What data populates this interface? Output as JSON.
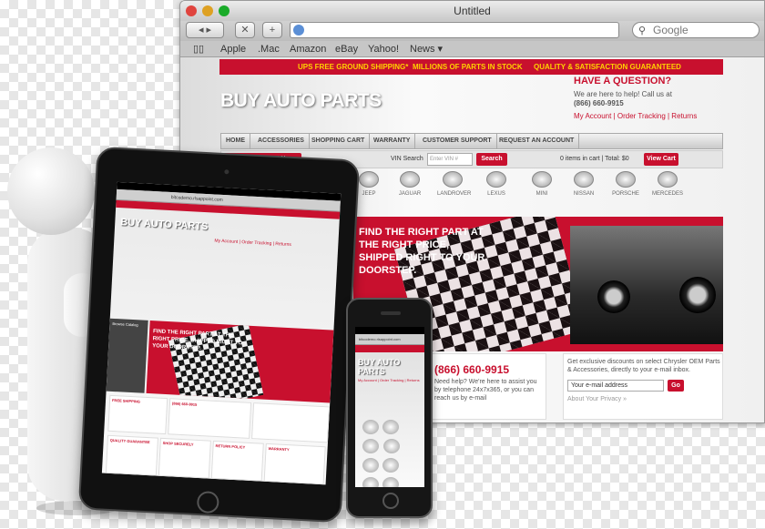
{
  "browser": {
    "title": "Untitled",
    "url": "",
    "search_placeholder": "Google",
    "nav_back": "◂ ▸",
    "nav_stop": "✕",
    "nav_add": "+",
    "bookmarks_icon": "book-icon",
    "bookmarks": [
      "Apple",
      ".Mac",
      "Amazon",
      "eBay",
      "Yahoo!",
      "News ▾"
    ]
  },
  "site": {
    "promo": [
      "UPS FREE GROUND SHIPPING*",
      "MILLIONS OF PARTS IN STOCK",
      "QUALITY & SATISFACTION GUARANTEED"
    ],
    "logo": "BUY AUTO PARTS",
    "question": "HAVE A QUESTION?",
    "help_line1": "We are here to help! Call us at",
    "help_phone": "(866) 660-9915",
    "account_links": "My Account | Order Tracking | Returns",
    "nav": [
      "HOME",
      "ACCESSORIES",
      "SHOPPING CART",
      "WARRANTY",
      "CUSTOMER SUPPORT",
      "REQUEST AN ACCOUNT"
    ],
    "search_by_part": "Search By Part N...",
    "vin_label": "VIN Search",
    "vin_placeholder": "Enter VIN #",
    "search_btn": "Search",
    "cart_text": "0 items in cart | Total: $0",
    "view_cart": "View Cart",
    "brands": [
      "JEEP",
      "JAGUAR",
      "LANDROVER",
      "LEXUS",
      "MINI",
      "NISSAN",
      "PORSCHE",
      "MERCEDES"
    ],
    "hero_text": "FIND THE RIGHT PART AT THE RIGHT PRICE, SHIPPED RIGHT TO YOUR DOORSTEP.",
    "phone_big": "(866) 660-9915",
    "phone_sub": "Need help? We're here to assist you by telephone 24x7x365, or you can reach us by e-mail",
    "news_text": "Get exclusive discounts on select Chrysler OEM Parts & Accessories, directly to your e-mail inbox.",
    "email_placeholder": "Your e-mail address",
    "go_btn": "Go",
    "privacy": "About Your Privacy »"
  },
  "tablet": {
    "url": "bitcodemo.rlsappoint.com",
    "logo": "BUY AUTO PARTS",
    "links": "My Account | Order Tracking | Returns",
    "side_title": "Browse Catalog",
    "hero_text": "FIND THE RIGHT PART AT THE RIGHT PRICE, SHIPPED RIGHT TO YOUR DOORSTEP.",
    "free_shipping": "FREE SHIPPING",
    "phone": "(866) 660-9915",
    "quality": "QUALITY GUARANTEE",
    "shop_secure": "SHOP SECURELY",
    "return_policy": "RETURN POLICY",
    "warranty": "WARRANTY"
  },
  "phone": {
    "url": "bitcodemo.rlsappoint.com",
    "logo": "BUY AUTO PARTS",
    "links": "My Account | Order Tracking | Returns"
  }
}
